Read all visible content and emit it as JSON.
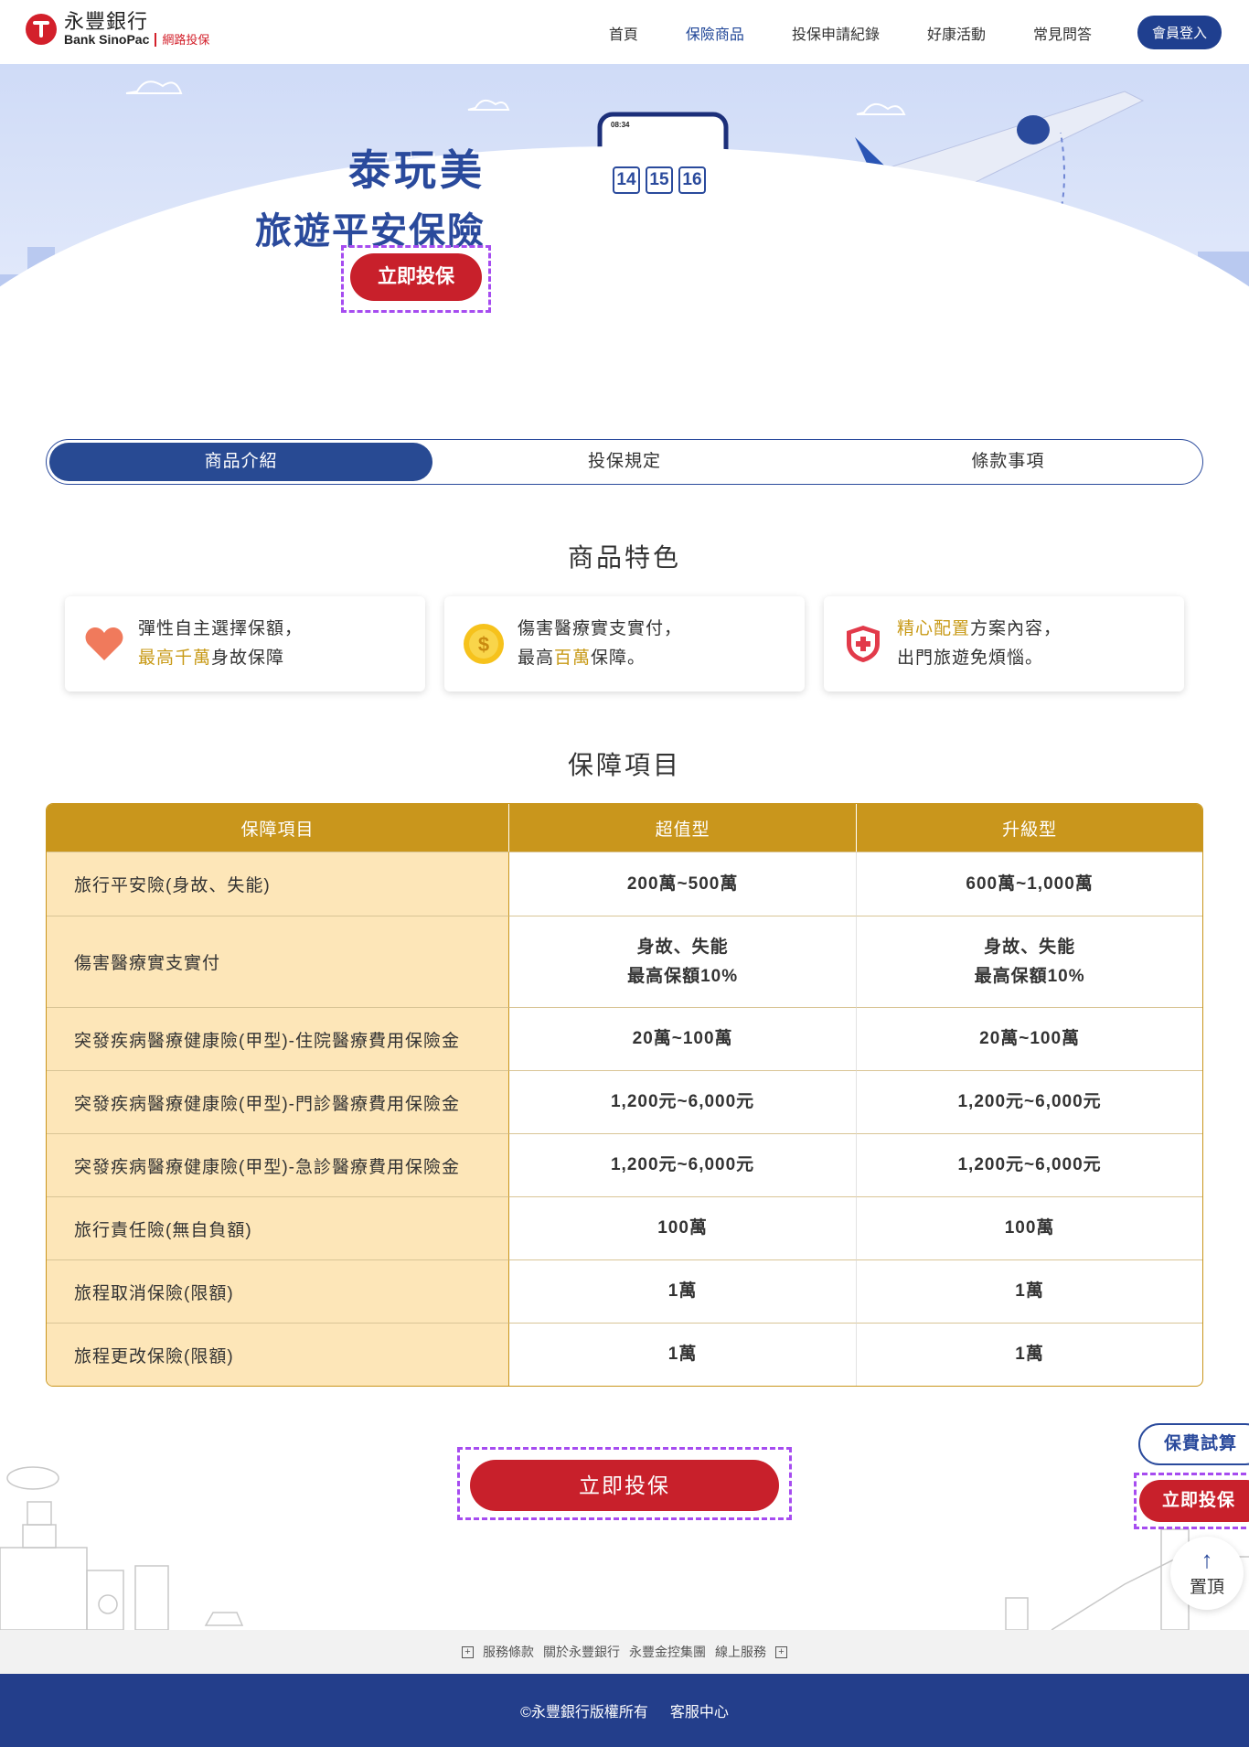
{
  "header": {
    "logo_cn": "永豐銀行",
    "logo_en": "Bank SinoPac",
    "logo_sub": "網路投保",
    "nav": [
      "首頁",
      "保險商品",
      "投保申請紀錄",
      "好康活動",
      "常見問答"
    ],
    "login": "會員登入",
    "active_color": "#1f4597"
  },
  "banner": {
    "title1": "泰玩美",
    "title2": "旅遊平安保險",
    "cta": "立即投保",
    "calendar_days": [
      "14",
      "15",
      "16"
    ],
    "phone_time": "08:34"
  },
  "tabs": [
    "商品介紹",
    "投保規定",
    "條款事項"
  ],
  "features": {
    "title": "商品特色",
    "cards": [
      {
        "icon": "heart-icon",
        "line1": "彈性自主選擇保額，",
        "hl": "最高千萬",
        "rest": "身故保障"
      },
      {
        "icon": "coin-icon",
        "line1": "傷害醫療實支實付，",
        "pre": "最高",
        "hl": "百萬",
        "rest": "保障。"
      },
      {
        "icon": "shield-icon",
        "hl": "精心配置",
        "rest": "方案內容，",
        "line2": "出門旅遊免煩惱。"
      }
    ]
  },
  "coverage": {
    "title": "保障項目",
    "headers": [
      "保障項目",
      "超值型",
      "升級型"
    ],
    "rows": [
      {
        "item": "旅行平安險(身故、失能)",
        "basic": "200萬~500萬",
        "upgrade": "600萬~1,000萬"
      },
      {
        "item": "傷害醫療實支實付",
        "basic": "身故、失能\n最高保額10%",
        "upgrade": "身故、失能\n最高保額10%"
      },
      {
        "item": "突發疾病醫療健康險(甲型)-住院醫療費用保險金",
        "basic": "20萬~100萬",
        "upgrade": "20萬~100萬"
      },
      {
        "item": "突發疾病醫療健康險(甲型)-門診醫療費用保險金",
        "basic": "1,200元~6,000元",
        "upgrade": "1,200元~6,000元"
      },
      {
        "item": "突發疾病醫療健康險(甲型)-急診醫療費用保險金",
        "basic": "1,200元~6,000元",
        "upgrade": "1,200元~6,000元"
      },
      {
        "item": "旅行責任險(無自負額)",
        "basic": "100萬",
        "upgrade": "100萬"
      },
      {
        "item": "旅程取消保險(限額)",
        "basic": "1萬",
        "upgrade": "1萬"
      },
      {
        "item": "旅程更改保險(限額)",
        "basic": "1萬",
        "upgrade": "1萬"
      }
    ]
  },
  "bottom_cta": "立即投保",
  "float": {
    "calc": "保費試算",
    "apply": "立即投保",
    "top": "置頂"
  },
  "footer": {
    "links": [
      "服務條款",
      "關於永豐銀行",
      "永豐金控集團",
      "線上服務"
    ],
    "copyright": "©永豐銀行版權所有",
    "service": "客服中心"
  },
  "colors": {
    "primary": "#284a93",
    "red": "#c8202b",
    "gold": "#c9961c",
    "row_bg": "#fde6b8"
  }
}
